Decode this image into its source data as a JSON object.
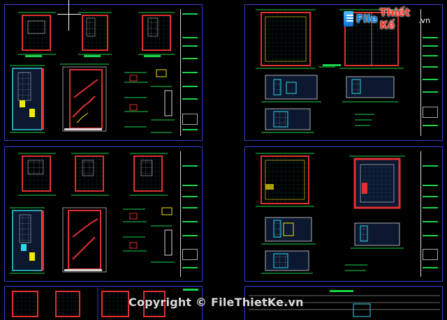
{
  "brand": {
    "name_part1": "File",
    "name_part2": "Thiết Kế",
    "domain_suffix": ".vn"
  },
  "watermark": {
    "text": "Copyright © FileThietKe.vn"
  },
  "colors": {
    "background": "#000000",
    "sheet_border": "#2b3fd6",
    "wall_red": "#e23030",
    "dim_green": "#19d34a",
    "grid_cyan": "#2fd6e6",
    "furniture_yellow": "#f2e60a",
    "frame_white": "#d8d8d8"
  },
  "sheets": [
    {
      "name": "sheet-top-left"
    },
    {
      "name": "sheet-top-right"
    },
    {
      "name": "sheet-middle-left"
    },
    {
      "name": "sheet-middle-right"
    },
    {
      "name": "sheet-bottom-left"
    },
    {
      "name": "sheet-bottom-right"
    }
  ]
}
